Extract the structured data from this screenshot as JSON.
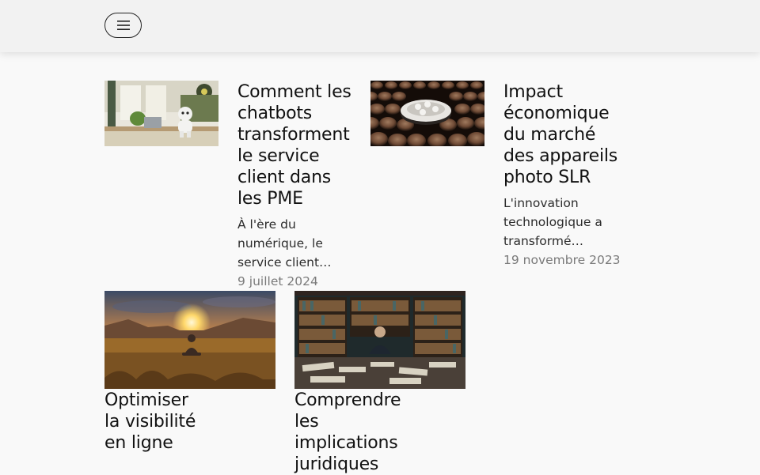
{
  "header": {
    "menu_icon": "hamburger-menu-icon"
  },
  "articles": [
    {
      "title": "Comment les chatbots transforment le service client dans les PME",
      "excerpt": "À l'ère du numérique, le service client…",
      "date": "9 juillet 2024",
      "image": "robot-at-desk-photo"
    },
    {
      "title": "Impact économique du marché des appareils photo SLR",
      "excerpt": "L'innovation technologique a transformé…",
      "date": "19 novembre 2023",
      "image": "camera-lenses-photo"
    },
    {
      "title": "Optimiser la visibilité en ligne",
      "image": "meditation-sunset-photo"
    },
    {
      "title": "Comprendre les implications juridiques",
      "image": "library-lawyer-photo"
    }
  ]
}
